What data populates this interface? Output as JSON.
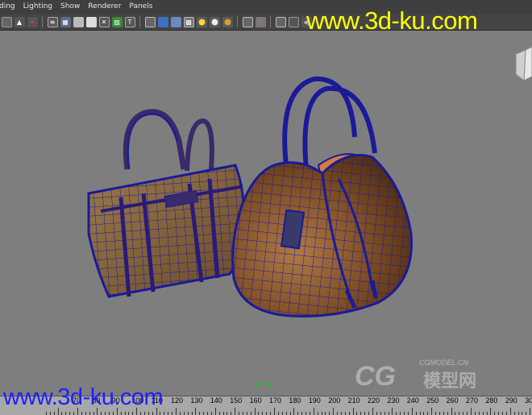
{
  "menu": [
    "ding",
    "Lighting",
    "Show",
    "Renderer",
    "Panels"
  ],
  "toolbar_icons": [
    "select-icon",
    "lasso-icon",
    "paint-icon",
    "wire-icon",
    "smooth-icon",
    "shade-icon",
    "texture-icon",
    "light-icon",
    "text-icon",
    "camera-icon",
    "cube-icon",
    "cube-blue-icon",
    "cube-grid-icon",
    "checker-icon",
    "sphere-yellow-icon",
    "sphere-white-icon",
    "sphere-gold-icon",
    "isolate-icon",
    "xray-icon",
    "cube-outline-icon",
    "cube-frame-icon",
    "share-icon"
  ],
  "viewport": {
    "camera_label": "persp"
  },
  "ruler": {
    "labels": [
      "70",
      "80",
      "90",
      "100",
      "110",
      "120",
      "130",
      "140",
      "150",
      "160",
      "170",
      "180",
      "190",
      "200",
      "210",
      "220",
      "230",
      "240",
      "250",
      "260",
      "270",
      "280",
      "290",
      "300"
    ]
  },
  "watermarks": {
    "top": "www.3d-ku.com",
    "bottom": "www.3d-ku.com",
    "cg_url": "CGMODEL.CN",
    "cg_logo": "CG",
    "cg_cn": "模型网"
  },
  "colors": {
    "menubar": "#3f3f3f",
    "viewport": "#7e7e7e",
    "wire": "#1a1a9a",
    "bag_leather": "#8a5a2e",
    "watermark_yellow": "#ffff00",
    "watermark_blue": "#2020ff"
  }
}
